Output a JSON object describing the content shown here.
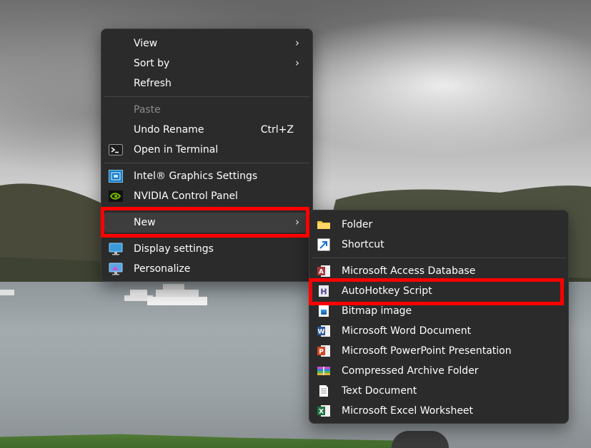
{
  "desktop": {
    "wallpaper": "loch-landscape"
  },
  "context_menu": {
    "items": [
      {
        "label": "View",
        "submenu": true
      },
      {
        "label": "Sort by",
        "submenu": true
      },
      {
        "label": "Refresh"
      },
      {
        "label": "Paste",
        "disabled": true
      },
      {
        "label": "Undo Rename",
        "shortcut": "Ctrl+Z"
      },
      {
        "label": "Open in Terminal",
        "icon": "terminal-icon"
      },
      {
        "label": "Intel® Graphics Settings",
        "icon": "intel-graphics-icon"
      },
      {
        "label": "NVIDIA Control Panel",
        "icon": "nvidia-icon"
      },
      {
        "label": "New",
        "submenu": true,
        "highlighted": true
      },
      {
        "label": "Display settings",
        "icon": "display-icon"
      },
      {
        "label": "Personalize",
        "icon": "personalize-icon"
      }
    ]
  },
  "new_submenu": {
    "items": [
      {
        "label": "Folder",
        "icon": "folder-icon"
      },
      {
        "label": "Shortcut",
        "icon": "shortcut-icon"
      },
      {
        "label": "Microsoft Access Database",
        "icon": "access-icon"
      },
      {
        "label": "AutoHotkey Script",
        "icon": "autohotkey-icon",
        "highlighted": true
      },
      {
        "label": "Bitmap image",
        "icon": "bitmap-icon"
      },
      {
        "label": "Microsoft Word Document",
        "icon": "word-icon"
      },
      {
        "label": "Microsoft PowerPoint Presentation",
        "icon": "powerpoint-icon"
      },
      {
        "label": "Compressed Archive Folder",
        "icon": "archive-icon"
      },
      {
        "label": "Text Document",
        "icon": "text-document-icon"
      },
      {
        "label": "Microsoft Excel Worksheet",
        "icon": "excel-icon"
      }
    ]
  },
  "annotation": {
    "highlight_color": "#ff0000"
  },
  "colors": {
    "menu_bg": "#2b2b2b",
    "menu_text": "#ffffff",
    "disabled_text": "#8a8a8a",
    "folder": "#f4c542",
    "access": "#a4373a",
    "word": "#2b579a",
    "powerpoint": "#d24726",
    "excel": "#217346"
  }
}
